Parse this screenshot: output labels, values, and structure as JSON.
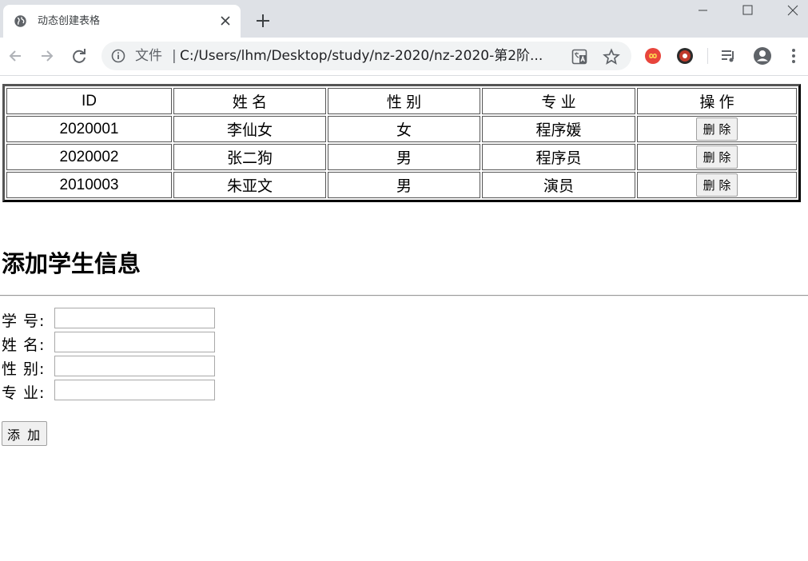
{
  "browser": {
    "tab_title": "动态创建表格",
    "address_scheme": "文件",
    "address_separator": "|",
    "address_url": "C:/Users/lhm/Desktop/study/nz-2020/nz-2020-第2阶..."
  },
  "table": {
    "headers": [
      "ID",
      "姓 名",
      "性 别",
      "专 业",
      "操 作"
    ],
    "rows": [
      {
        "id": "2020001",
        "name": "李仙女",
        "gender": "女",
        "major": "程序媛",
        "action": "删 除"
      },
      {
        "id": "2020002",
        "name": "张二狗",
        "gender": "男",
        "major": "程序员",
        "action": "删 除"
      },
      {
        "id": "2010003",
        "name": "朱亚文",
        "gender": "男",
        "major": "演员",
        "action": "删 除"
      }
    ]
  },
  "form": {
    "title": "添加学生信息",
    "fields": [
      {
        "label": "学 号:",
        "value": ""
      },
      {
        "label": "姓 名:",
        "value": ""
      },
      {
        "label": "性 别:",
        "value": ""
      },
      {
        "label": "专 业:",
        "value": ""
      }
    ],
    "submit_label": "添 加"
  },
  "icons": {
    "tab_favicon": "globe-icon",
    "close": "close-icon",
    "new_tab": "plus-icon",
    "back": "arrow-left-icon",
    "forward": "arrow-right-icon",
    "reload": "reload-icon",
    "info": "info-icon",
    "translate": "translate-icon",
    "bookmark": "star-icon",
    "media": "media-control-icon",
    "profile": "profile-icon",
    "menu": "kebab-menu-icon"
  },
  "colors": {
    "tabbar_bg": "#dee1e6",
    "omnibox_bg": "#f1f3f4",
    "ext1": "#e8453c",
    "ext2": "#c0392b"
  }
}
